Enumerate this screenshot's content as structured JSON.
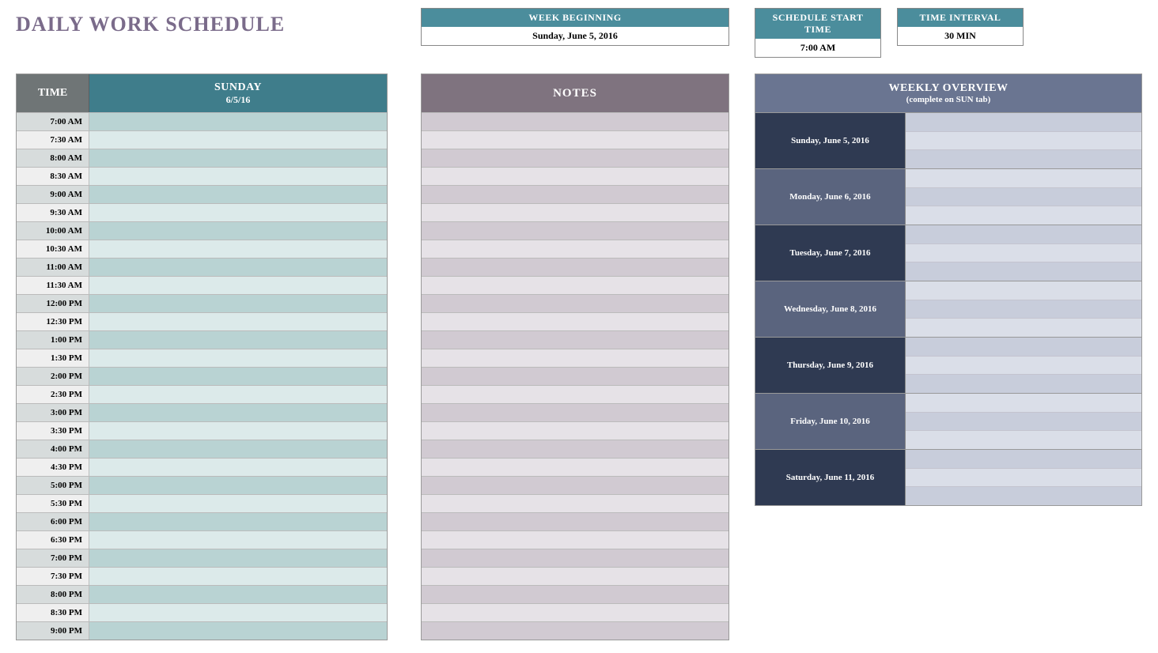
{
  "title": "DAILY WORK SCHEDULE",
  "info": {
    "week_label": "WEEK BEGINNING",
    "week_value": "Sunday, June 5, 2016",
    "start_label": "SCHEDULE START TIME",
    "start_value": "7:00 AM",
    "interval_label": "TIME INTERVAL",
    "interval_value": "30 MIN"
  },
  "schedule": {
    "time_header": "TIME",
    "day_name": "SUNDAY",
    "day_date": "6/5/16",
    "times": [
      "7:00 AM",
      "7:30 AM",
      "8:00 AM",
      "8:30 AM",
      "9:00 AM",
      "9:30 AM",
      "10:00 AM",
      "10:30 AM",
      "11:00 AM",
      "11:30 AM",
      "12:00 PM",
      "12:30 PM",
      "1:00 PM",
      "1:30 PM",
      "2:00 PM",
      "2:30 PM",
      "3:00 PM",
      "3:30 PM",
      "4:00 PM",
      "4:30 PM",
      "5:00 PM",
      "5:30 PM",
      "6:00 PM",
      "6:30 PM",
      "7:00 PM",
      "7:30 PM",
      "8:00 PM",
      "8:30 PM",
      "9:00 PM"
    ],
    "events": [
      "",
      "",
      "",
      "",
      "",
      "",
      "",
      "",
      "",
      "",
      "",
      "",
      "",
      "",
      "",
      "",
      "",
      "",
      "",
      "",
      "",
      "",
      "",
      "",
      "",
      "",
      "",
      "",
      ""
    ]
  },
  "notes": {
    "header": "NOTES",
    "rows": [
      "",
      "",
      "",
      "",
      "",
      "",
      "",
      "",
      "",
      "",
      "",
      "",
      "",
      "",
      "",
      "",
      "",
      "",
      "",
      "",
      "",
      "",
      "",
      "",
      "",
      "",
      "",
      "",
      ""
    ]
  },
  "overview": {
    "header1": "WEEKLY OVERVIEW",
    "header2": "(complete on SUN tab)",
    "days": [
      "Sunday, June 5, 2016",
      "Monday, June 6, 2016",
      "Tuesday, June 7, 2016",
      "Wednesday, June 8, 2016",
      "Thursday, June 9, 2016",
      "Friday, June 10, 2016",
      "Saturday, June 11, 2016"
    ]
  }
}
